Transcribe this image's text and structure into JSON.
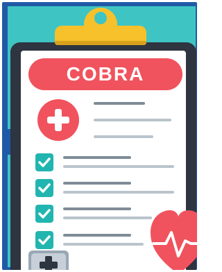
{
  "title": "COBRA",
  "colors": {
    "frame": "#1f5aa6",
    "background": "#3fc4c4",
    "board": "#2e3440",
    "clip": "#f6c12b",
    "accent_red": "#f0535d",
    "check_teal": "#21b5b0",
    "line_gray": "#b9c4cc"
  },
  "icons": [
    "clipboard-icon",
    "medical-plus-icon",
    "checkbox-icon",
    "heart-pulse-icon",
    "first-aid-kit-icon"
  ],
  "checklist_count": 4
}
